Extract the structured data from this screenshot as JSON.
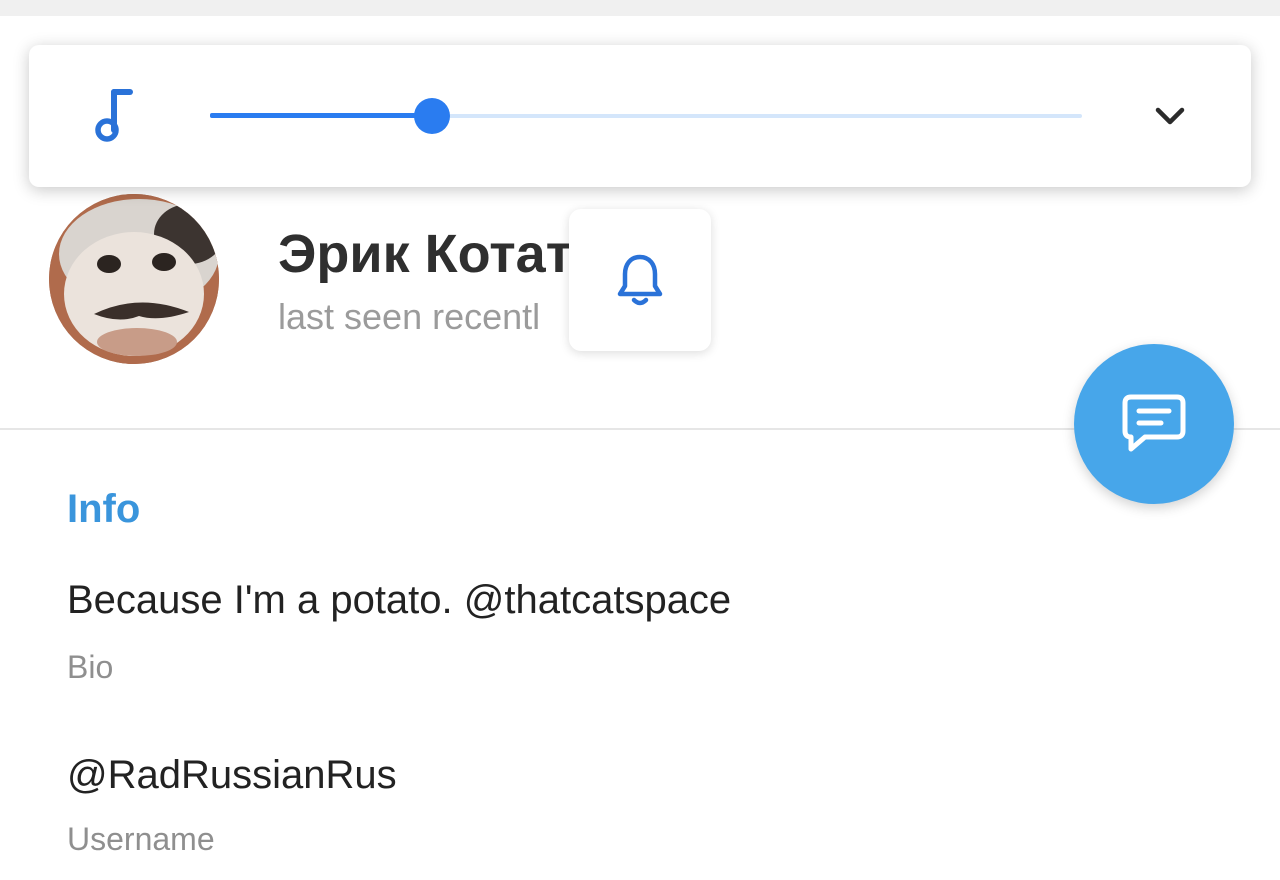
{
  "player": {
    "music_icon": "music-note-icon",
    "collapse_icon": "chevron-down-icon",
    "progress": 0.255,
    "accent": "#2a7cf0",
    "track_color": "#d4e6fb"
  },
  "profile": {
    "name": "Эрик Котат",
    "status": "last seen recentl",
    "avatar_icon": "avatar-photo",
    "bell_icon": "bell-icon",
    "message_icon": "message-icon",
    "fab_color": "#47a6ea"
  },
  "info": {
    "heading": "Info",
    "bio_value": "Because I'm a potato. @thatcatspace",
    "bio_label": "Bio",
    "username_value": "@RadRussianRus",
    "username_label": "Username"
  }
}
